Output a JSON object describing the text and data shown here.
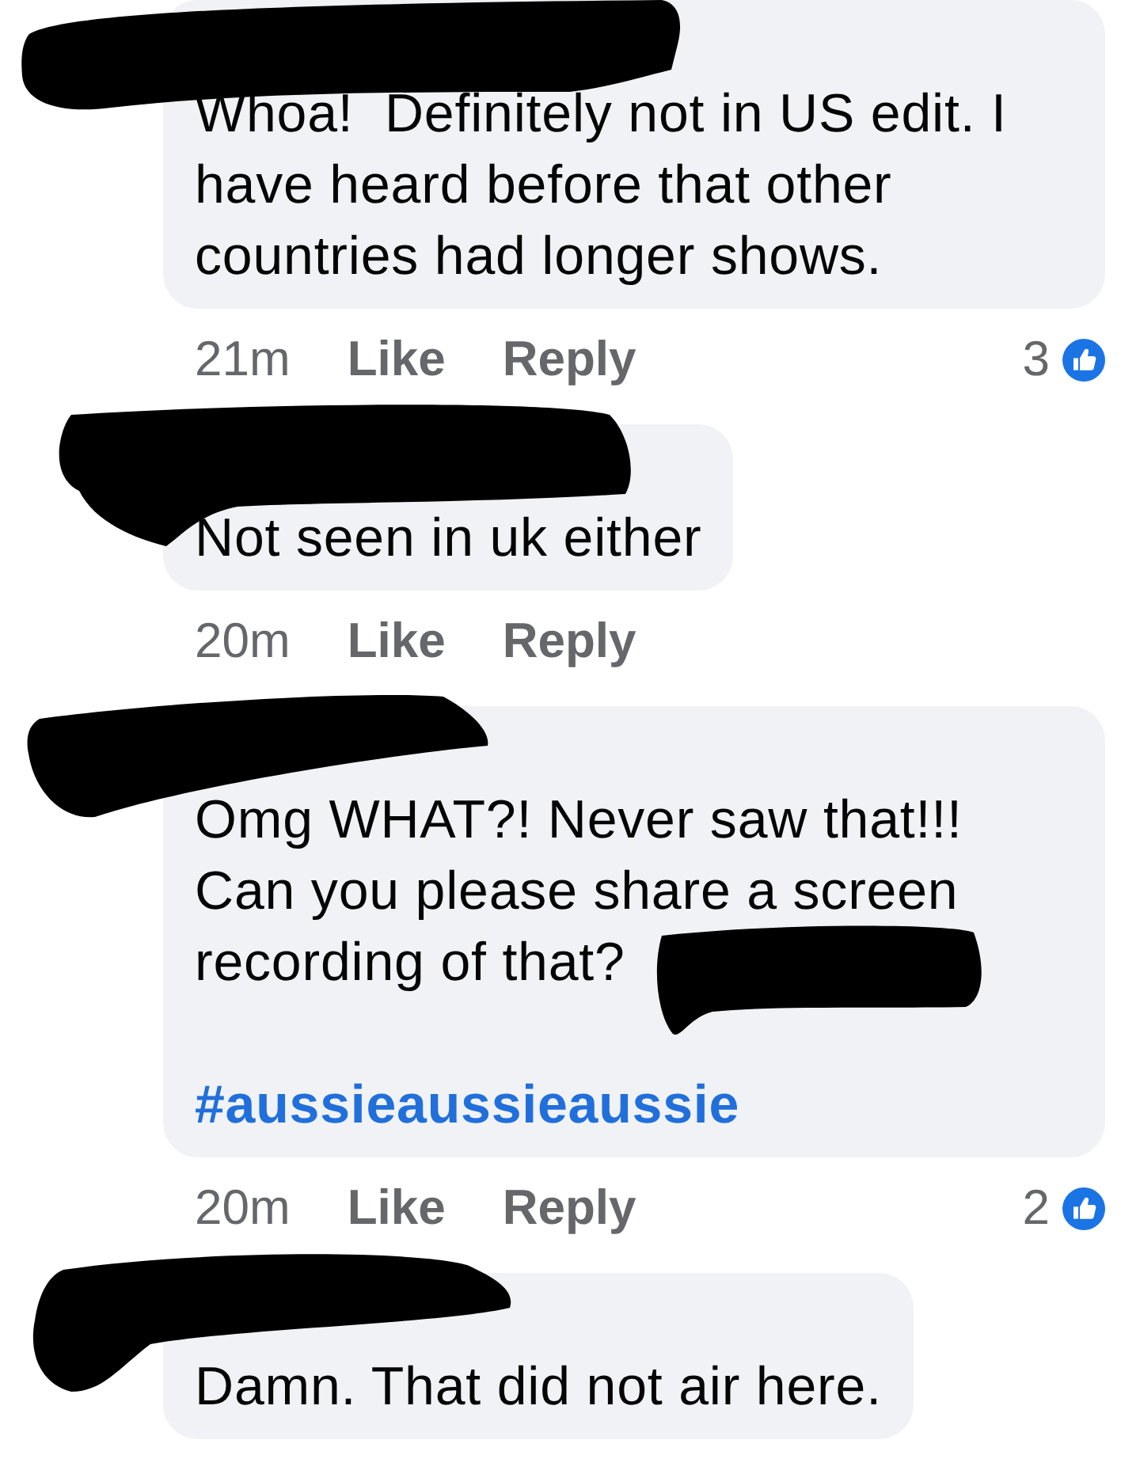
{
  "comments": [
    {
      "name_redacted": true,
      "text": "Whoa!  Definitely not in US edit. I have heard before that other countries had longer shows.",
      "time": "21m",
      "like_label": "Like",
      "reply_label": "Reply",
      "reactions": "3"
    },
    {
      "name_redacted": true,
      "text": "Not seen in uk either",
      "time": "20m",
      "like_label": "Like",
      "reply_label": "Reply"
    },
    {
      "name_redacted": true,
      "text": "Omg WHAT?! Never saw that!!!\nCan you please share a screen recording of that?",
      "mention_redacted": true,
      "hashtag": "#aussieaussieaussie",
      "time": "20m",
      "like_label": "Like",
      "reply_label": "Reply",
      "reactions": "2"
    },
    {
      "name_redacted": true,
      "text": "Damn. That did not air here."
    }
  ]
}
